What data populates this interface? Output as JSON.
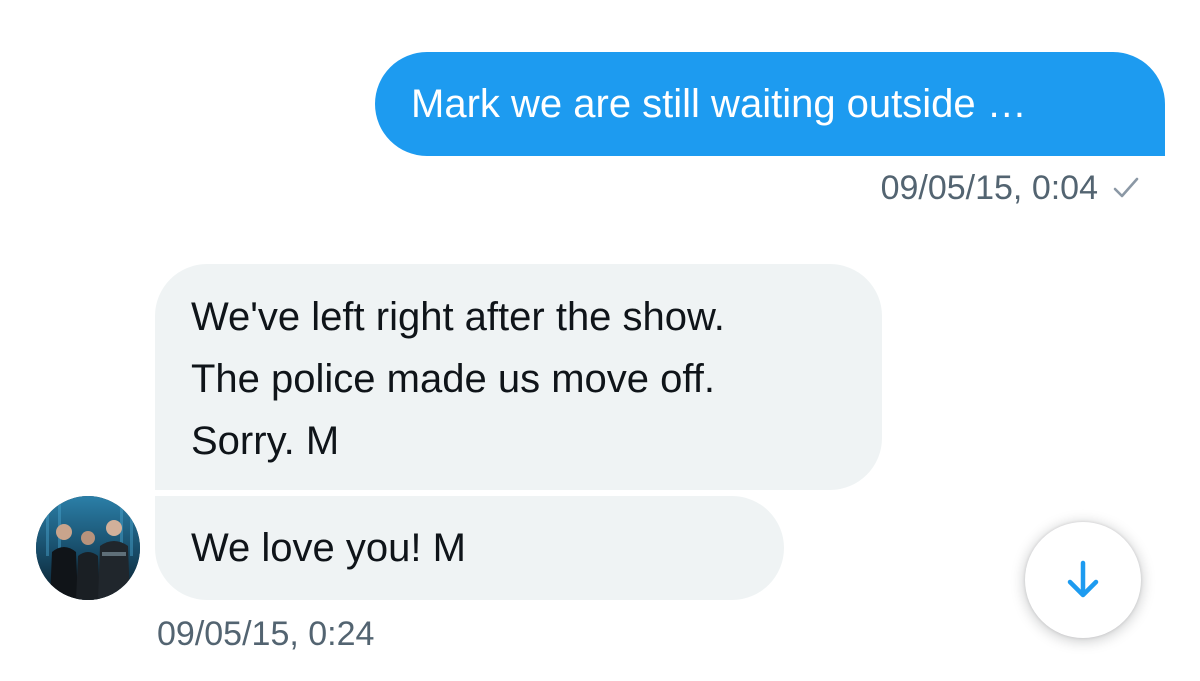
{
  "conversation": {
    "sent_message": {
      "text": "Mark we are still waiting outside …",
      "timestamp": "09/05/15, 0:04",
      "status_icon": "checkmark-icon"
    },
    "received_messages": [
      {
        "lines": [
          "We've left right after the show.",
          "The police made us move off.",
          "Sorry. M"
        ]
      },
      {
        "text": "We love you! M"
      }
    ],
    "received_timestamp": "09/05/15, 0:24"
  },
  "controls": {
    "scroll_down_icon": "arrow-down-icon"
  },
  "colors": {
    "sent_bubble": "#1d9bf0",
    "received_bubble": "#eff3f4",
    "meta_text": "#536471",
    "check": "#8b98a5",
    "accent": "#1d9bf0"
  }
}
